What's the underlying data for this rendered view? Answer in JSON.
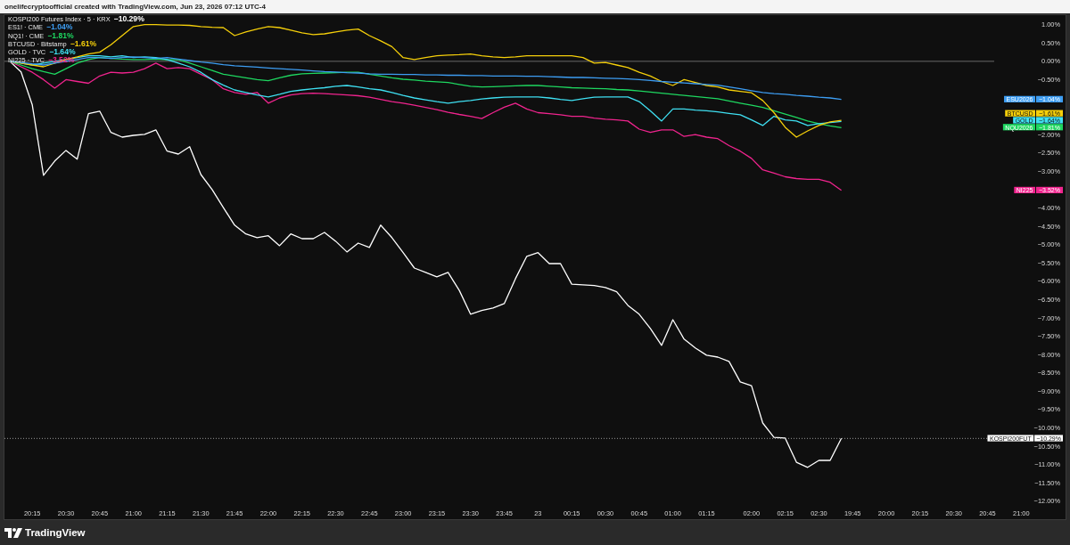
{
  "header": {
    "text": "onelifecryptoofficial created with TradingView.com, Jun 23, 2026 07:12 UTC-4"
  },
  "legend": [
    {
      "label": "KOSPI200 Futures Index · 5 · KRX",
      "change": "−10.29%",
      "color": "#ffffff"
    },
    {
      "label": "ES1! · CME",
      "change": "−1.04%",
      "color": "#3d9df2"
    },
    {
      "label": "NQ1! · CME",
      "change": "−1.81%",
      "color": "#1ed760"
    },
    {
      "label": "BTCUSD · Bitstamp",
      "change": "−1.61%",
      "color": "#f5cf0a"
    },
    {
      "label": "GOLD · TVC",
      "change": "−1.64%",
      "color": "#3fe0f2"
    },
    {
      "label": "NI225 · TVC",
      "change": "−3.52%",
      "color": "#f0248e"
    }
  ],
  "chart_data": {
    "type": "line",
    "legend": "right",
    "ylim": [
      -12,
      1
    ],
    "ref_lines": [
      {
        "axis": "y",
        "value": -10.29
      }
    ],
    "categories": [
      null,
      null,
      "20:15",
      null,
      null,
      "20:30",
      null,
      null,
      "20:45",
      null,
      null,
      "21:00",
      null,
      null,
      "21:15",
      null,
      null,
      "21:30",
      null,
      null,
      "21:45",
      null,
      null,
      "22:00",
      null,
      null,
      "22:15",
      null,
      null,
      "22:30",
      null,
      null,
      "22:45",
      null,
      null,
      "23:00",
      null,
      null,
      "23:15",
      null,
      null,
      "23:30",
      null,
      null,
      "23:45",
      null,
      null,
      "23",
      null,
      null,
      "00:15",
      null,
      null,
      "00:30",
      null,
      null,
      "00:45",
      null,
      null,
      "01:00",
      null,
      null,
      "01:15",
      null,
      null,
      null,
      "02:00",
      null,
      null,
      "02:15",
      null,
      null,
      "02:30",
      null,
      null,
      "19:45",
      null,
      null,
      "20:00",
      null,
      null,
      "20:15",
      null,
      null,
      "20:30",
      null,
      null,
      "20:45",
      null,
      null,
      "21:00"
    ],
    "yticks": [
      {
        "value": 1,
        "label": "1.00%"
      },
      {
        "value": 0.5,
        "label": "0.50%"
      },
      {
        "value": 0,
        "label": "0.00%"
      },
      {
        "value": -0.5,
        "label": "−0.50%"
      },
      {
        "value": -2,
        "label": "−2.00%"
      },
      {
        "value": -2.5,
        "label": "−2.50%"
      },
      {
        "value": -3,
        "label": "−3.00%"
      },
      {
        "value": -4,
        "label": "−4.00%"
      },
      {
        "value": -4.5,
        "label": "−4.50%"
      },
      {
        "value": -5,
        "label": "−5.00%"
      },
      {
        "value": -5.5,
        "label": "−5.50%"
      },
      {
        "value": -6,
        "label": "−6.00%"
      },
      {
        "value": -6.5,
        "label": "−6.50%"
      },
      {
        "value": -7,
        "label": "−7.00%"
      },
      {
        "value": -7.5,
        "label": "−7.50%"
      },
      {
        "value": -8,
        "label": "−8.00%"
      },
      {
        "value": -8.5,
        "label": "−8.50%"
      },
      {
        "value": -9,
        "label": "−9.00%"
      },
      {
        "value": -9.5,
        "label": "−9.50%"
      },
      {
        "value": -10,
        "label": "−10.00%"
      },
      {
        "value": -10.5,
        "label": "−10.50%"
      },
      {
        "value": -11,
        "label": "−11.00%"
      },
      {
        "value": -11.5,
        "label": "−11.50%"
      },
      {
        "value": -12,
        "label": "−12.00%"
      }
    ],
    "series": [
      {
        "name": "ESU2026",
        "color": "#3d9df2",
        "values": [
          0,
          -0.03,
          -0.07,
          -0.1,
          -0.05,
          0,
          0.05,
          0.1,
          0.1,
          0.08,
          0.1,
          0.12,
          0.1,
          0.08,
          0.1,
          0.06,
          0.02,
          -0.02,
          -0.05,
          -0.09,
          -0.12,
          -0.14,
          -0.16,
          -0.18,
          -0.2,
          -0.22,
          -0.24,
          -0.26,
          -0.28,
          -0.29,
          -0.31,
          -0.32,
          -0.34,
          -0.35,
          -0.35,
          -0.36,
          -0.36,
          -0.37,
          -0.37,
          -0.38,
          -0.38,
          -0.39,
          -0.39,
          -0.4,
          -0.4,
          -0.4,
          -0.41,
          -0.41,
          -0.42,
          -0.43,
          -0.44,
          -0.44,
          -0.45,
          -0.46,
          -0.47,
          -0.48,
          -0.5,
          -0.52,
          -0.55,
          -0.57,
          -0.59,
          -0.61,
          -0.63,
          -0.65,
          -0.7,
          -0.75,
          -0.8,
          -0.85,
          -0.88,
          -0.9,
          -0.93,
          -0.95,
          -0.98,
          -1.0,
          -1.04,
          null,
          null,
          null,
          null,
          null,
          null,
          null,
          null,
          null,
          null,
          null,
          null,
          null,
          null,
          null,
          null
        ]
      },
      {
        "name": "BTCUSD",
        "color": "#f5cf0a",
        "values": [
          0,
          -0.05,
          -0.1,
          -0.15,
          -0.05,
          0.05,
          0.12,
          0.2,
          0.25,
          0.45,
          0.7,
          0.95,
          1.0,
          1.0,
          0.99,
          0.99,
          0.98,
          0.95,
          0.93,
          0.92,
          0.7,
          0.8,
          0.88,
          0.95,
          0.92,
          0.85,
          0.78,
          0.73,
          0.75,
          0.8,
          0.85,
          0.88,
          0.7,
          0.56,
          0.4,
          0.1,
          0.05,
          0.1,
          0.15,
          0.17,
          0.18,
          0.2,
          0.15,
          0.12,
          0.1,
          0.12,
          0.15,
          0.15,
          0.15,
          0.15,
          0.15,
          0.1,
          -0.05,
          -0.03,
          -0.1,
          -0.17,
          -0.3,
          -0.4,
          -0.55,
          -0.66,
          -0.5,
          -0.58,
          -0.66,
          -0.7,
          -0.78,
          -0.82,
          -0.86,
          -1.07,
          -1.4,
          -1.8,
          -2.07,
          -1.9,
          -1.75,
          -1.65,
          -1.61,
          null,
          null,
          null,
          null,
          null,
          null,
          null,
          null,
          null,
          null,
          null,
          null,
          null,
          null,
          null,
          null
        ]
      },
      {
        "name": "GOLD",
        "color": "#3fe0f2",
        "values": [
          0,
          -0.05,
          -0.1,
          -0.05,
          0,
          0.05,
          0.1,
          0.15,
          0.15,
          0.12,
          0.15,
          0.1,
          0.12,
          0.1,
          0.05,
          -0.05,
          -0.15,
          -0.3,
          -0.5,
          -0.65,
          -0.78,
          -0.85,
          -0.92,
          -0.97,
          -0.9,
          -0.82,
          -0.78,
          -0.75,
          -0.72,
          -0.68,
          -0.66,
          -0.7,
          -0.75,
          -0.78,
          -0.85,
          -0.93,
          -1.0,
          -1.05,
          -1.1,
          -1.14,
          -1.1,
          -1.07,
          -1.03,
          -1.0,
          -0.98,
          -0.97,
          -0.97,
          -0.97,
          -1.0,
          -1.04,
          -1.07,
          -1.02,
          -0.98,
          -0.97,
          -0.97,
          -0.97,
          -1.1,
          -1.35,
          -1.63,
          -1.3,
          -1.3,
          -1.33,
          -1.35,
          -1.38,
          -1.42,
          -1.46,
          -1.6,
          -1.75,
          -1.5,
          -1.6,
          -1.63,
          -1.75,
          -1.7,
          -1.67,
          -1.64,
          null,
          null,
          null,
          null,
          null,
          null,
          null,
          null,
          null,
          null,
          null,
          null,
          null,
          null,
          null,
          null
        ]
      },
      {
        "name": "NQU2026",
        "color": "#1ed760",
        "values": [
          0,
          -0.1,
          -0.2,
          -0.28,
          -0.35,
          -0.2,
          -0.05,
          0.05,
          0.1,
          0.08,
          0.06,
          0.05,
          0.05,
          0.06,
          0.04,
          0.05,
          -0.05,
          -0.15,
          -0.25,
          -0.35,
          -0.4,
          -0.45,
          -0.5,
          -0.53,
          -0.45,
          -0.38,
          -0.34,
          -0.33,
          -0.32,
          -0.31,
          -0.3,
          -0.3,
          -0.35,
          -0.4,
          -0.45,
          -0.49,
          -0.51,
          -0.54,
          -0.56,
          -0.58,
          -0.63,
          -0.68,
          -0.7,
          -0.69,
          -0.68,
          -0.67,
          -0.66,
          -0.66,
          -0.68,
          -0.7,
          -0.72,
          -0.73,
          -0.74,
          -0.75,
          -0.77,
          -0.78,
          -0.81,
          -0.84,
          -0.87,
          -0.9,
          -0.93,
          -0.96,
          -0.99,
          -1.02,
          -1.08,
          -1.14,
          -1.2,
          -1.26,
          -1.35,
          -1.44,
          -1.53,
          -1.63,
          -1.7,
          -1.76,
          -1.81,
          null,
          null,
          null,
          null,
          null,
          null,
          null,
          null,
          null,
          null,
          null,
          null,
          null,
          null,
          null,
          null
        ]
      },
      {
        "name": "NI225",
        "color": "#f0248e",
        "values": [
          0,
          -0.15,
          -0.3,
          -0.5,
          -0.73,
          -0.5,
          -0.55,
          -0.6,
          -0.4,
          -0.3,
          -0.32,
          -0.3,
          -0.2,
          -0.05,
          -0.2,
          -0.17,
          -0.2,
          -0.35,
          -0.5,
          -0.75,
          -0.85,
          -0.9,
          -0.85,
          -1.14,
          -1.0,
          -0.92,
          -0.88,
          -0.87,
          -0.88,
          -0.9,
          -0.92,
          -0.94,
          -0.98,
          -1.04,
          -1.1,
          -1.14,
          -1.2,
          -1.26,
          -1.32,
          -1.39,
          -1.45,
          -1.5,
          -1.56,
          -1.4,
          -1.25,
          -1.14,
          -1.3,
          -1.4,
          -1.43,
          -1.46,
          -1.5,
          -1.5,
          -1.55,
          -1.58,
          -1.6,
          -1.63,
          -1.85,
          -1.94,
          -1.87,
          -1.87,
          -2.05,
          -2.0,
          -2.07,
          -2.11,
          -2.3,
          -2.45,
          -2.65,
          -2.96,
          -3.05,
          -3.15,
          -3.2,
          -3.22,
          -3.22,
          -3.3,
          -3.52,
          null,
          null,
          null,
          null,
          null,
          null,
          null,
          null,
          null,
          null,
          null,
          null,
          null,
          null,
          null,
          null
        ]
      },
      {
        "name": "KOSPI200FUT",
        "color": "#ffffff",
        "values": [
          0,
          -0.29,
          -1.19,
          -3.11,
          -2.72,
          -2.43,
          -2.67,
          -1.43,
          -1.36,
          -1.94,
          -2.07,
          -2.02,
          -1.99,
          -1.87,
          -2.45,
          -2.53,
          -2.33,
          -3.09,
          -3.5,
          -3.99,
          -4.47,
          -4.71,
          -4.81,
          -4.76,
          -5.03,
          -4.71,
          -4.84,
          -4.84,
          -4.67,
          -4.91,
          -5.2,
          -4.96,
          -5.08,
          -4.47,
          -4.81,
          -5.22,
          -5.64,
          -5.76,
          -5.88,
          -5.76,
          -6.25,
          -6.9,
          -6.8,
          -6.73,
          -6.61,
          -5.93,
          -5.32,
          -5.22,
          -5.52,
          -5.52,
          -6.08,
          -6.1,
          -6.12,
          -6.17,
          -6.29,
          -6.66,
          -6.9,
          -7.29,
          -7.75,
          -7.05,
          -7.58,
          -7.82,
          -8.02,
          -8.07,
          -8.19,
          -8.75,
          -8.85,
          -9.87,
          -10.26,
          -10.28,
          -10.94,
          -11.08,
          -10.89,
          -10.89,
          -10.29,
          null,
          null,
          null,
          null,
          null,
          null,
          null,
          null,
          null,
          null,
          null,
          null,
          null,
          null,
          null,
          null
        ]
      }
    ]
  },
  "price_labels": [
    {
      "value": "−1.04%"
    },
    {
      "value": "−1.61%"
    },
    {
      "value": "−1.64%"
    },
    {
      "value": "−1.81%"
    },
    {
      "value": "−3.52%"
    },
    {
      "value": "−10.29%"
    }
  ],
  "footer": {
    "logo_text": "TradingView"
  }
}
